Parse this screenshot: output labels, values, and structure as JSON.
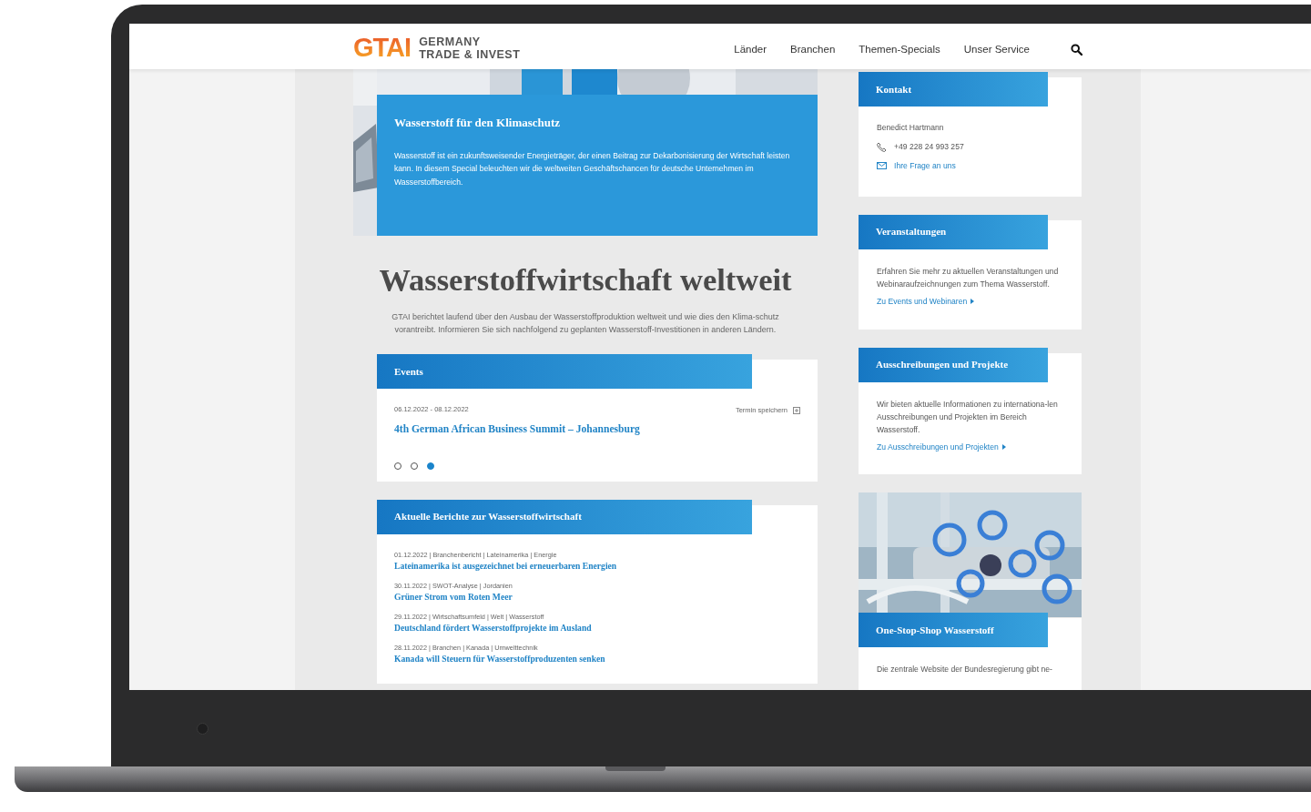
{
  "header": {
    "logo": "GTAI",
    "brand_line_1": "GERMANY",
    "brand_line_2": "TRADE & INVEST",
    "nav": [
      "Länder",
      "Branchen",
      "Themen-Specials",
      "Unser Service"
    ]
  },
  "hero": {
    "title": "Wasserstoff für den Klimaschutz",
    "text": "Wasserstoff ist ein zukunftsweisender Energieträger, der einen Beitrag zur Dekarbonisierung der Wirtschaft leisten kann. In diesem Special beleuchten wir die weltweiten Geschäftschancen für deutsche Unternehmen im Wasserstoffbereich."
  },
  "intro": {
    "title": "Wasserstoffwirtschaft weltweit",
    "text": "GTAI berichtet laufend über den Ausbau der Wasserstoffproduktion weltweit und wie dies den Klima-schutz vorantreibt. Informieren Sie sich nachfolgend zu geplanten Wasserstoff-Investitionen in anderen Ländern."
  },
  "events": {
    "title": "Events",
    "date": "06.12.2022 - 08.12.2022",
    "save_label": "Termin speichern",
    "event_title": "4th German African Business Summit – Johannesburg",
    "dots": [
      {
        "selected": false
      },
      {
        "selected": false
      },
      {
        "selected": true
      }
    ]
  },
  "reports": {
    "title": "Aktuelle Berichte zur Wasserstoffwirtschaft",
    "items": [
      {
        "meta": "01.12.2022 | Branchenbericht | Lateinamerika | Energie",
        "title": "Lateinamerika ist ausgezeichnet bei erneuerbaren Energien"
      },
      {
        "meta": "30.11.2022 | SWOT-Analyse | Jordanien",
        "title": "Grüner Strom vom Roten Meer"
      },
      {
        "meta": "29.11.2022 | Wirtschaftsumfeld | Welt | Wasserstoff",
        "title": "Deutschland fördert Wasserstoffprojekte im Ausland"
      },
      {
        "meta": "28.11.2022 | Branchen | Kanada | Umwelttechnik",
        "title": "Kanada will Steuern für Wasserstoffproduzenten senken"
      }
    ]
  },
  "sidebar": {
    "contact": {
      "title": "Kontakt",
      "name": "Benedict Hartmann",
      "phone": "+49 228 24 993 257",
      "link": "Ihre Frage an uns"
    },
    "boxes": [
      {
        "title": "Veranstaltungen",
        "text": "Erfahren Sie mehr zu aktuellen Veranstaltungen und Webinaraufzeichnungen zum Thema Wasserstoff.",
        "link": "Zu Events und Webinaren"
      },
      {
        "title": "Ausschreibungen und Projekte",
        "text": "Wir bieten aktuelle Informationen zu internationa-len Ausschreibungen und Projekten im Bereich Wasserstoff.",
        "link": "Zu Ausschreibungen und Projekten"
      }
    ],
    "shop": {
      "title": "One-Stop-Shop Wasserstoff",
      "text": "Die zentrale Website der Bundesregierung gibt ne-"
    }
  }
}
